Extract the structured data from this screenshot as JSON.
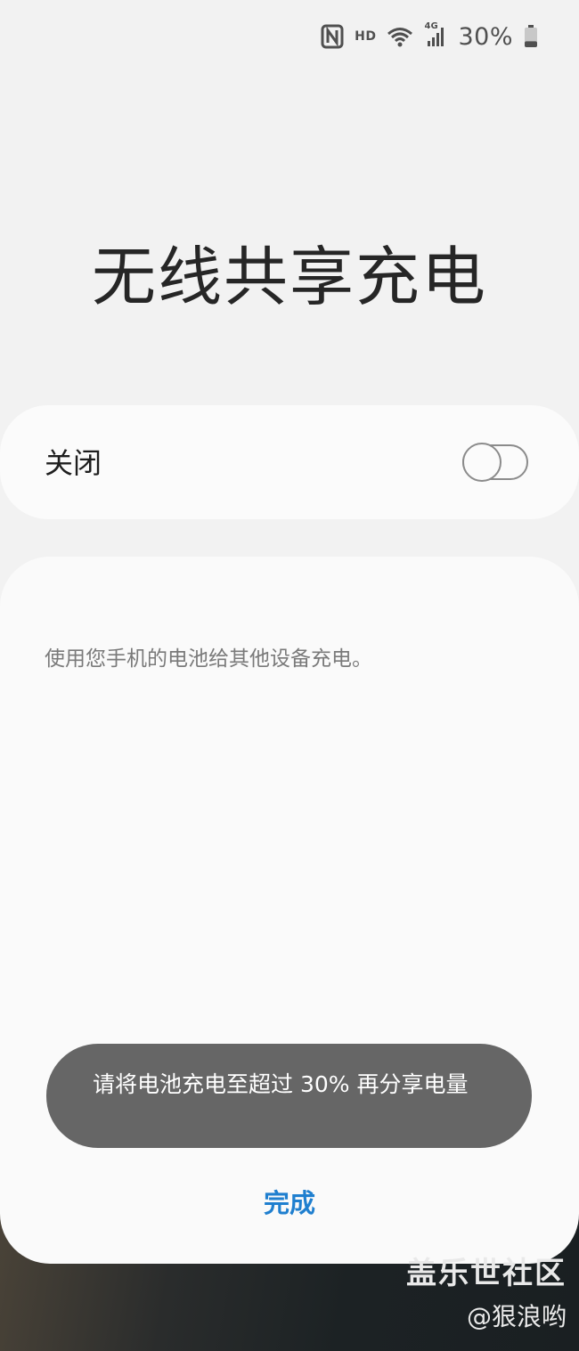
{
  "status_bar": {
    "icons": [
      "nfc-icon",
      "hd-icon",
      "wifi-icon",
      "4g-signal-icon",
      "battery-icon"
    ],
    "hd_label": "HD",
    "network_label": "4G",
    "battery_percent": "30%",
    "battery_level": 0.3
  },
  "page": {
    "title": "无线共享充电"
  },
  "toggle": {
    "label": "关闭",
    "state": "off"
  },
  "sheet": {
    "description": "使用您手机的电池给其他设备充电。",
    "toast_message": "请将电池充电至超过 30% 再分享电量",
    "done_label": "完成"
  },
  "watermark": {
    "line1": "盖乐世社区",
    "line2": "@狠浪哟"
  },
  "colors": {
    "background": "#f2f2f2",
    "card": "#fbfbfb",
    "accent": "#1f7fcf",
    "toast_bg": "#666666"
  }
}
